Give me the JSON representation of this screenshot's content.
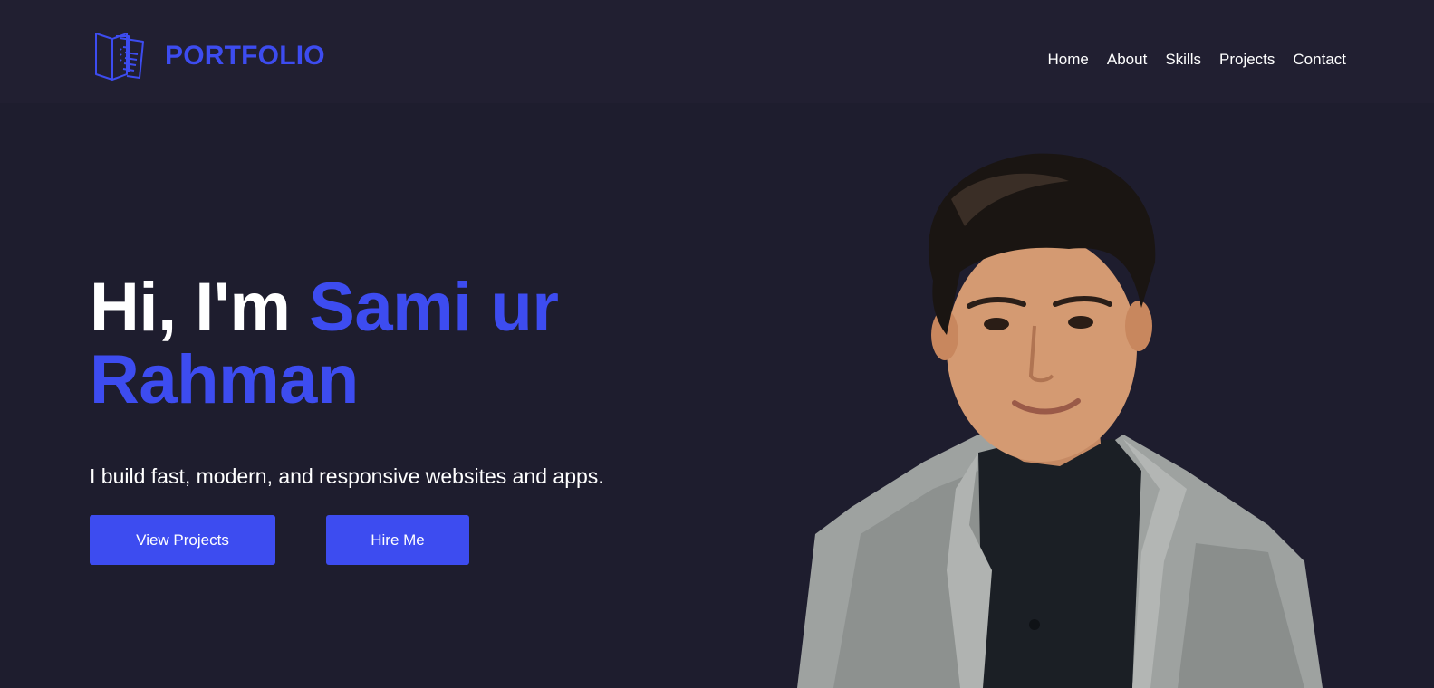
{
  "header": {
    "logo_icon": "document-stack-icon",
    "logo_text": "PORTFOLIO",
    "nav": [
      {
        "label": "Home"
      },
      {
        "label": "About"
      },
      {
        "label": "Skills"
      },
      {
        "label": "Projects"
      },
      {
        "label": "Contact"
      }
    ]
  },
  "hero": {
    "greeting": "Hi, I'm",
    "name_line1": "Sami ur",
    "name_line2": "Rahman",
    "subtitle": "I build fast, modern, and responsive websites and apps.",
    "primary_button": "View Projects",
    "secondary_button": "Hire Me",
    "portrait": "profile-photo"
  },
  "colors": {
    "background": "#1e1d2e",
    "navbar": "#211f31",
    "accent": "#3d4cf0",
    "text": "#ffffff"
  }
}
